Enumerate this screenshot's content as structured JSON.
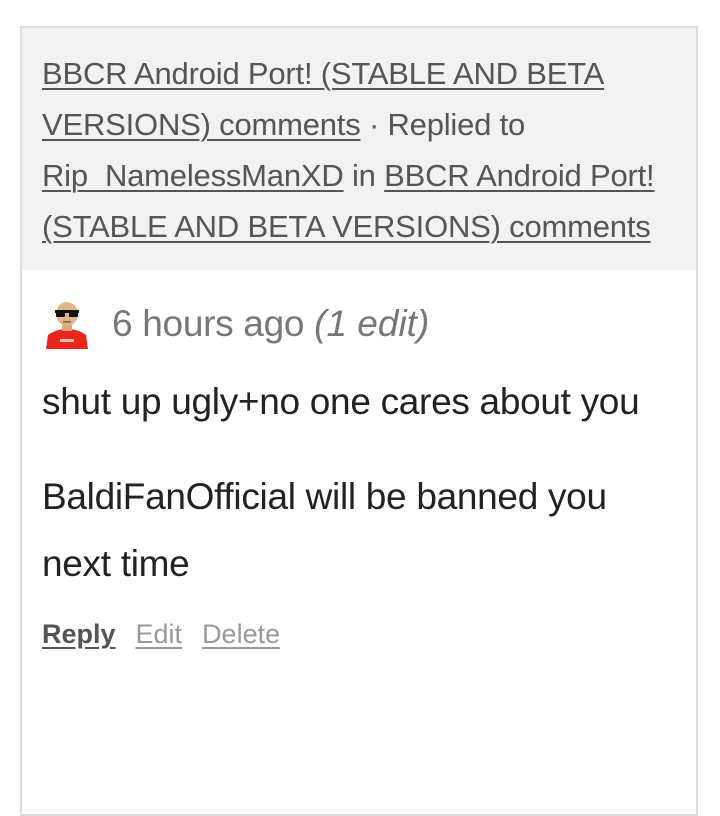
{
  "header": {
    "thread_link": "BBCR Android Port! (STABLE AND BETA VERSIONS) comments",
    "separator": " · Replied to ",
    "user_link": "Rip_NamelessManXD",
    "in_text": " in ",
    "game_link": "BBCR Android Port! (STABLE AND BETA VERSIONS) comments"
  },
  "comment": {
    "avatar_icon": "user-avatar-icon",
    "time": "6 hours ago",
    "edit_note": "(1 edit)",
    "paragraphs": [
      "shut up ugly+no one cares about you",
      "BaldiFanOfficial will be banned you next time"
    ]
  },
  "actions": {
    "reply": "Reply",
    "edit": "Edit",
    "delete": "Delete"
  }
}
